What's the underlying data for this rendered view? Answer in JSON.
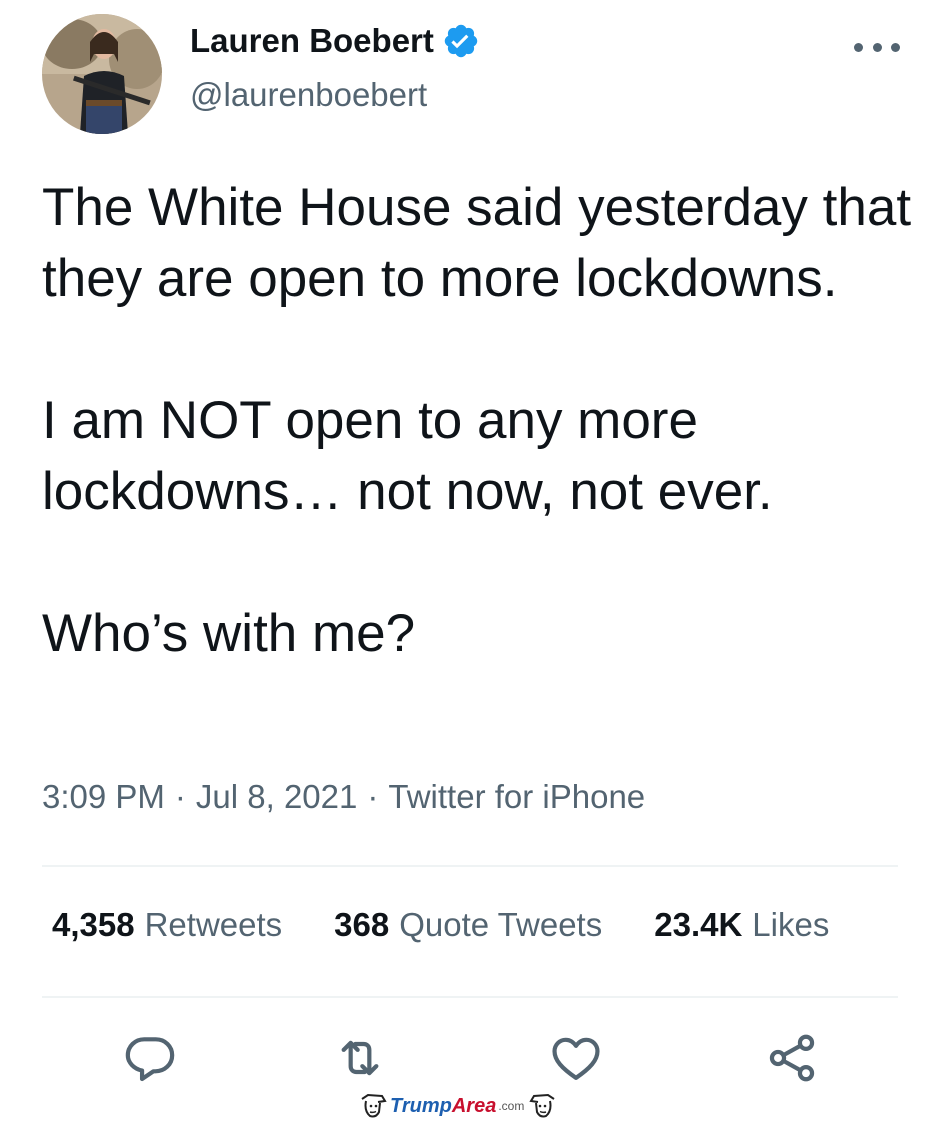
{
  "header": {
    "display_name": "Lauren Boebert",
    "handle": "@laurenboebert",
    "verified": true
  },
  "tweet": {
    "paragraphs": [
      "The White House said yesterday that they are open to more lockdowns.",
      "I am NOT open to any more lockdowns… not now, not ever.",
      "Who’s with me?"
    ]
  },
  "meta": {
    "time": "3:09 PM",
    "date": "Jul 8, 2021",
    "source": "Twitter for iPhone",
    "separator": "·"
  },
  "stats": {
    "retweets_count": "4,358",
    "retweets_label": "Retweets",
    "quotes_count": "368",
    "quotes_label": "Quote Tweets",
    "likes_count": "23.4K",
    "likes_label": "Likes"
  },
  "actions": [
    {
      "icon": "reply-icon"
    },
    {
      "icon": "retweet-icon"
    },
    {
      "icon": "like-icon"
    },
    {
      "icon": "share-icon"
    }
  ],
  "watermark": {
    "brand_trump": "Trump",
    "brand_area": "Area",
    "brand_suffix": ".com"
  },
  "colors": {
    "text_primary": "#0f1419",
    "text_secondary": "#536471",
    "verified_blue": "#1d9bf0",
    "divider": "#eff3f4"
  }
}
